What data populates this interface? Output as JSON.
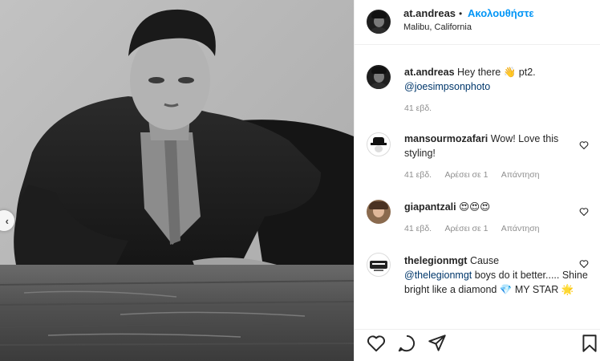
{
  "post": {
    "username": "at.andreas",
    "separator": "•",
    "follow_label": "Ακολουθήστε",
    "location": "Malibu, California"
  },
  "caption": {
    "username": "at.andreas",
    "text": "Hey there",
    "emoji": "👋",
    "text_after": "pt2.",
    "mention": "@joesimpsonphoto",
    "time": "41 εβδ."
  },
  "comments": [
    {
      "username": "mansourmozafari",
      "text": "Wow! Love this styling!",
      "time": "41 εβδ.",
      "likes": "Αρέσει σε 1",
      "reply": "Απάντηση"
    },
    {
      "username": "giapantzali",
      "text": "😍😍😍",
      "time": "41 εβδ.",
      "likes": "Αρέσει σε 1",
      "reply": "Απάντηση"
    },
    {
      "username": "thelegionmgt",
      "text_before": "Cause",
      "mention": "@thelegionmgt",
      "text_after": "boys do it better..... Shine bright like a diamond 💎 MY STAR 🌟"
    }
  ],
  "icons": {
    "like": "heart-icon",
    "comment": "comment-icon",
    "share": "send-icon",
    "save": "bookmark-icon",
    "prev": "chevron-left-icon"
  },
  "colors": {
    "follow": "#0095f6",
    "mention": "#00376b",
    "meta": "#8e8e8e",
    "border": "#efefef"
  }
}
